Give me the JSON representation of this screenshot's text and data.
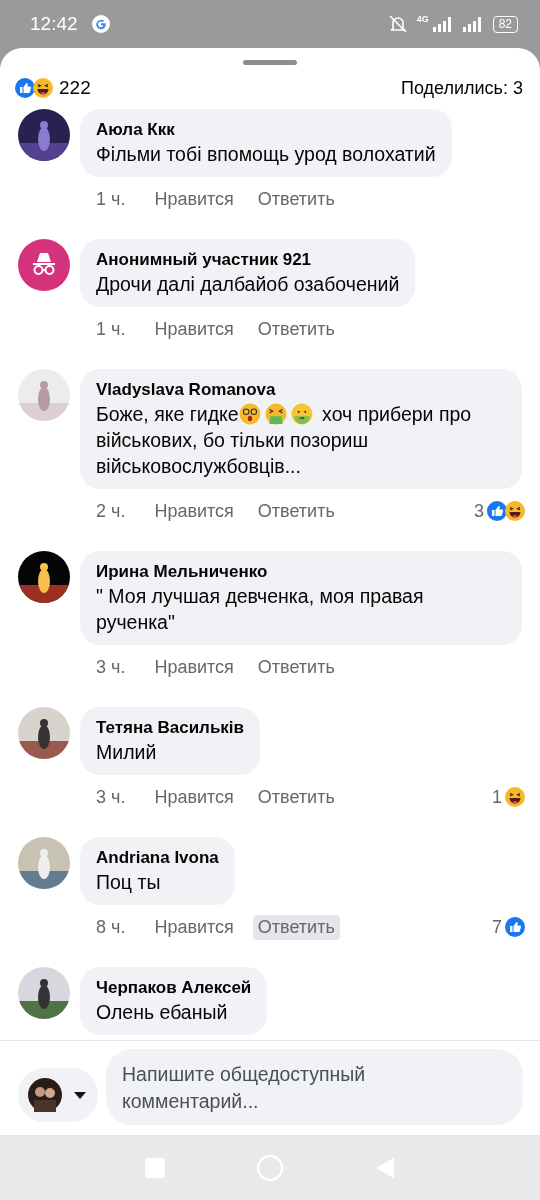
{
  "status_bar": {
    "time": "12:42",
    "network": "4G",
    "battery": "82"
  },
  "header": {
    "reactions": [
      {
        "kind": "like"
      },
      {
        "kind": "haha"
      }
    ],
    "count": "222",
    "shares": "Поделились: 3"
  },
  "comments": [
    {
      "avatar": {
        "kind": "picture"
      },
      "author": "Аюла Ккк",
      "body": [
        {
          "kind": "text",
          "text": "Фільми тобі впомощь урод волохатий"
        }
      ],
      "time": "1 ч.",
      "like": "Нравится",
      "reply": "Ответить",
      "reply_highlighted": false
    },
    {
      "avatar": {
        "kind": "incognito"
      },
      "author": "Анонимный участник 921",
      "body": [
        {
          "kind": "text",
          "text": "Дрочи далі далбайоб озабочений"
        }
      ],
      "time": "1 ч.",
      "like": "Нравится",
      "reply": "Ответить",
      "reply_highlighted": false
    },
    {
      "avatar": {
        "kind": "picture"
      },
      "author": "Vladyslava Romanova",
      "body": [
        {
          "kind": "text",
          "text": "Боже, яке гидке"
        },
        {
          "kind": "dizzy"
        },
        {
          "kind": "vomit"
        },
        {
          "kind": "nauseated"
        },
        {
          "kind": "text",
          "text": " хоч прибери про військових, бо тільки позориш військовослужбовців..."
        }
      ],
      "time": "2 ч.",
      "like": "Нравится",
      "reply": "Ответить",
      "reply_highlighted": false,
      "reactions": {
        "count": "3",
        "types": [
          {
            "kind": "like"
          },
          {
            "kind": "haha"
          }
        ]
      }
    },
    {
      "avatar": {
        "kind": "picture"
      },
      "author": "Ирина Мельниченко",
      "body": [
        {
          "kind": "text",
          "text": "\" Моя лучшая девченка, моя правая рученка\""
        }
      ],
      "time": "3 ч.",
      "like": "Нравится",
      "reply": "Ответить",
      "reply_highlighted": false
    },
    {
      "avatar": {
        "kind": "picture"
      },
      "author": "Тетяна Васильків",
      "body": [
        {
          "kind": "text",
          "text": "Милий"
        }
      ],
      "time": "3 ч.",
      "like": "Нравится",
      "reply": "Ответить",
      "reply_highlighted": false,
      "reactions": {
        "count": "1",
        "types": [
          {
            "kind": "haha"
          }
        ]
      }
    },
    {
      "avatar": {
        "kind": "picture"
      },
      "author": "Andriana Ivona",
      "body": [
        {
          "kind": "text",
          "text": "Поц ты"
        }
      ],
      "time": "8 ч.",
      "like": "Нравится",
      "reply": "Ответить",
      "reply_highlighted": true,
      "reactions": {
        "count": "7",
        "types": [
          {
            "kind": "like"
          }
        ]
      }
    },
    {
      "avatar": {
        "kind": "picture"
      },
      "author": "Черпаков Алексей",
      "body": [
        {
          "kind": "text",
          "text": "Олень ебаный"
        }
      ]
    }
  ],
  "composer": {
    "placeholder": "Напишите общедоступный комментарий..."
  }
}
